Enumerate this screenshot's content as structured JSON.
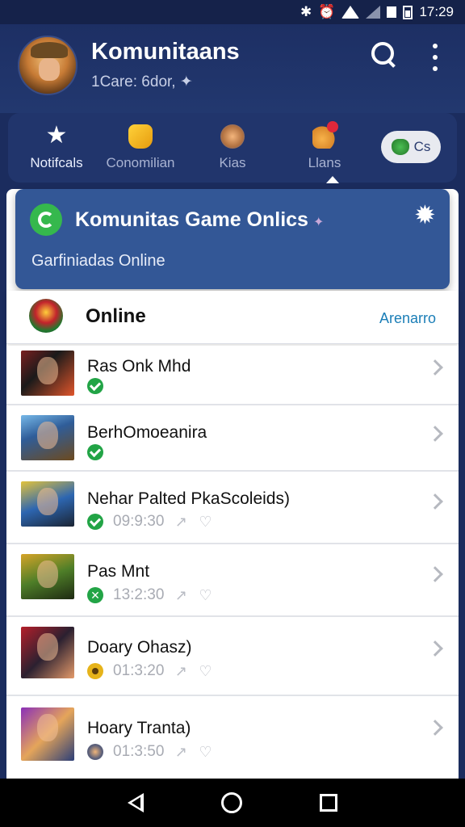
{
  "status_bar": {
    "time": "17:29"
  },
  "header": {
    "title": "Komunitaans",
    "subtitle": "1Care: 6dor, ✦"
  },
  "tabs": [
    {
      "label": "Notifcals",
      "icon": "star-icon"
    },
    {
      "label": "Conomilian",
      "icon": "community-icon"
    },
    {
      "label": "Kias",
      "icon": "avatar-icon"
    },
    {
      "label": "Llans",
      "icon": "badge-icon"
    }
  ],
  "chip": {
    "label": "Cs"
  },
  "banner": {
    "title": "Komunitas Game Onlics",
    "subtitle": "Garfiniadas Online"
  },
  "online": {
    "label": "Online",
    "link": "Arenarro"
  },
  "list": [
    {
      "title": "Ras Onk Mhd",
      "status": "online",
      "time": ""
    },
    {
      "title": "BerhOmoeanira",
      "status": "online",
      "time": ""
    },
    {
      "title": "Nehar Palted PkaScoleids)",
      "status": "online",
      "time": "09:9:30"
    },
    {
      "title": "Pas Mnt",
      "status": "playing",
      "time": "13:2:30"
    },
    {
      "title": "Doary Ohasz)",
      "status": "away",
      "time": "01:3:20"
    },
    {
      "title": "Hoary Tranta)",
      "status": "idle",
      "time": "01:3:50"
    }
  ],
  "colors": {
    "primary_bg": "#1b2c5e",
    "banner_bg": "#335796",
    "accent_green": "#22a446",
    "link": "#1b7eb7"
  }
}
